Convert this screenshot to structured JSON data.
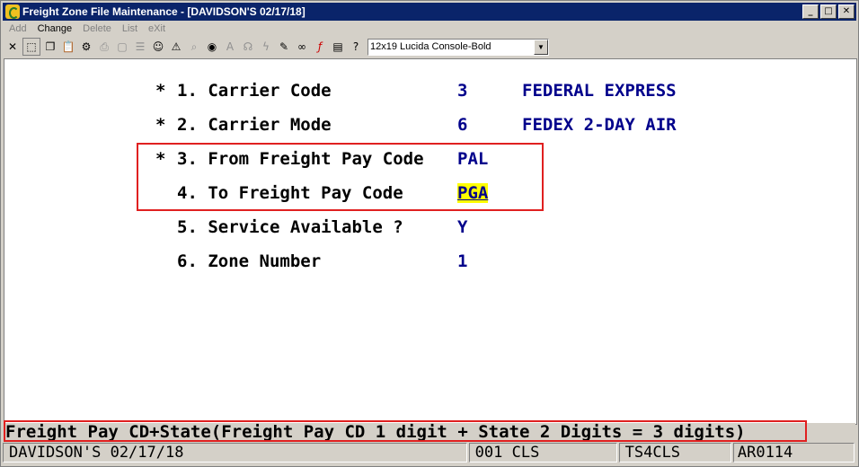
{
  "window": {
    "title": "Freight Zone File Maintenance - [DAVIDSON'S 02/17/18]"
  },
  "menu": {
    "add": "Add",
    "change": "Change",
    "delete": "Delete",
    "list": "List",
    "exit": "eXit"
  },
  "toolbar": {
    "icons": [
      "close-icon",
      "select-icon",
      "copy-icon",
      "paste-icon",
      "gear-icon",
      "print-icon",
      "new-icon",
      "notes-icon",
      "user-icon",
      "alert-icon",
      "search-icon",
      "globe-icon",
      "font-icon",
      "voice-icon",
      "lightning-icon",
      "edit-icon",
      "link-icon",
      "function-icon",
      "document-icon",
      "help-icon"
    ],
    "font_select": "12x19 Lucida Console-Bold",
    "font_arrow": "▼"
  },
  "fields": [
    {
      "marker": "*",
      "label": "1. Carrier Code",
      "value": "3",
      "desc": "FEDERAL EXPRESS"
    },
    {
      "marker": "*",
      "label": "2. Carrier Mode",
      "value": "6",
      "desc": "FEDEX 2-DAY AIR"
    },
    {
      "marker": "*",
      "label": "3. From Freight Pay Code",
      "value": "PAL",
      "desc": ""
    },
    {
      "marker": "",
      "label": "4. To Freight Pay Code",
      "value": "PGA",
      "desc": ""
    },
    {
      "marker": "",
      "label": "5. Service Available ?",
      "value": "Y",
      "desc": ""
    },
    {
      "marker": "",
      "label": "6. Zone Number",
      "value": "1",
      "desc": ""
    }
  ],
  "message": "Freight Pay CD+State(Freight Pay CD 1 digit + State 2 Digits = 3 digits)",
  "status": {
    "company": "DAVIDSON'S 02/17/18",
    "terminal": "001 CLS",
    "session": "TS4CLS",
    "program": "AR0114"
  },
  "colors": {
    "title_bar": "#0a246a",
    "value_text": "#00008b",
    "highlight": "#ffff00",
    "callout_box": "#e02020"
  }
}
